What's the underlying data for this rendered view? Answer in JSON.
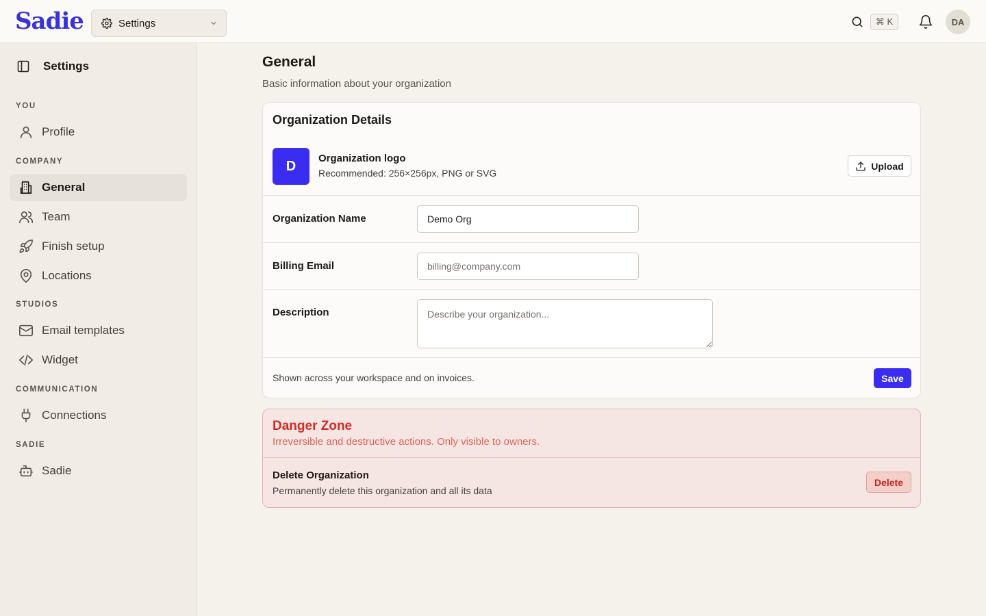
{
  "app": {
    "name": "Sadie",
    "brand_color": "#3a34d6",
    "accent_color": "#3a2cf0",
    "danger_color": "#d42a22"
  },
  "header": {
    "workspace_select": {
      "icon": "gear-icon",
      "label": "Settings"
    },
    "search_shortcut": "⌘ K",
    "avatar_initials": "DA"
  },
  "sidebar": {
    "title": "Settings",
    "sections": [
      {
        "label": "YOU",
        "items": [
          {
            "label": "Profile",
            "icon": "user-icon"
          }
        ]
      },
      {
        "label": "COMPANY",
        "items": [
          {
            "label": "General",
            "icon": "building-icon",
            "active": true
          },
          {
            "label": "Team",
            "icon": "users-icon"
          },
          {
            "label": "Finish setup",
            "icon": "rocket-icon"
          },
          {
            "label": "Locations",
            "icon": "map-pin-icon"
          }
        ]
      },
      {
        "label": "STUDIOS",
        "items": [
          {
            "label": "Email templates",
            "icon": "mail-icon"
          },
          {
            "label": "Widget",
            "icon": "code-icon"
          }
        ]
      },
      {
        "label": "COMMUNICATION",
        "items": [
          {
            "label": "Connections",
            "icon": "plug-icon"
          }
        ]
      },
      {
        "label": "SADIE",
        "items": [
          {
            "label": "Sadie",
            "icon": "bot-icon"
          }
        ]
      }
    ]
  },
  "main": {
    "title": "General",
    "subtitle": "Basic information about your organization",
    "org_card": {
      "title": "Organization Details",
      "logo_initial": "D",
      "logo_label": "Organization logo",
      "logo_hint": "Recommended: 256×256px, PNG or SVG",
      "upload_label": "Upload",
      "fields": {
        "name": {
          "label": "Organization Name",
          "value": "Demo Org"
        },
        "email": {
          "label": "Billing Email",
          "value": "",
          "placeholder": "billing@company.com"
        },
        "description": {
          "label": "Description",
          "value": "",
          "placeholder": "Describe your organization..."
        }
      },
      "footer_note": "Shown across your workspace and on invoices.",
      "save_label": "Save"
    },
    "danger_zone": {
      "title": "Danger Zone",
      "subtitle": "Irreversible and destructive actions. Only visible to owners.",
      "delete_title": "Delete Organization",
      "delete_desc": "Permanently delete this organization and all its data",
      "delete_label": "Delete"
    }
  }
}
